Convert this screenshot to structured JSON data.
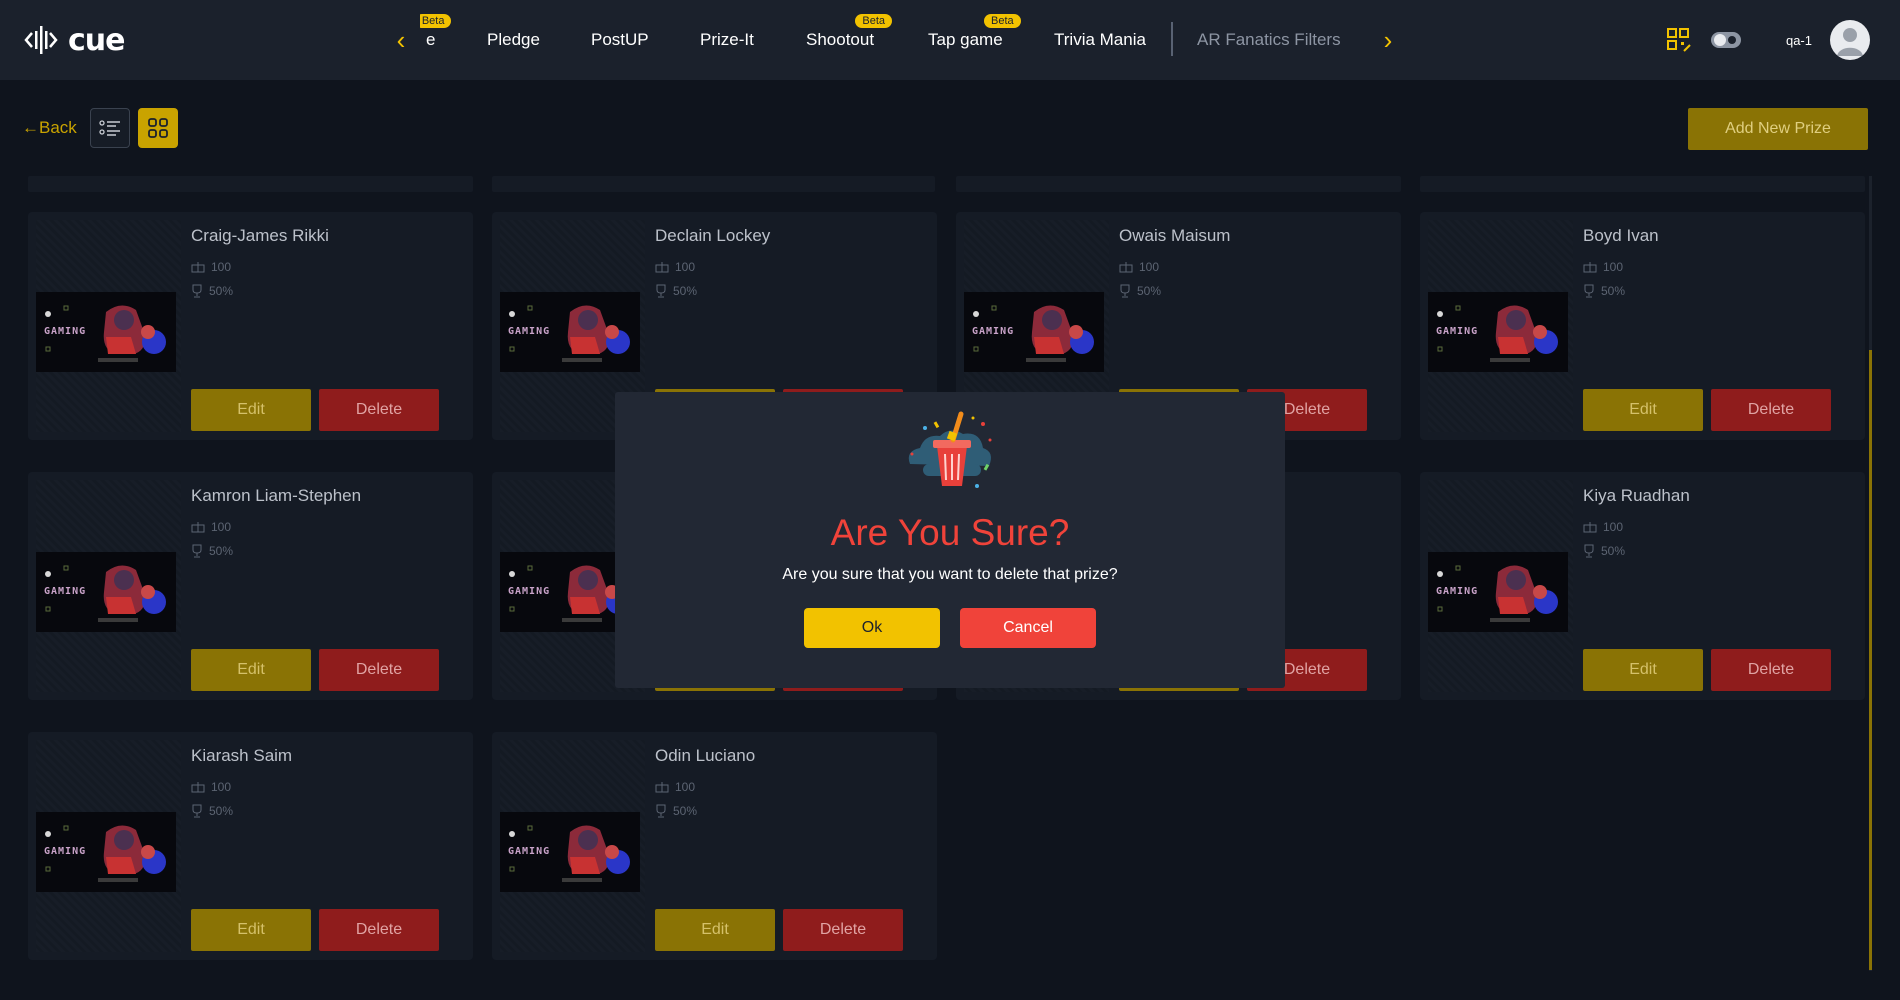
{
  "header": {
    "logo_text": "cue",
    "nav_items": [
      {
        "label": "e",
        "beta": "Beta"
      },
      {
        "label": "Pledge"
      },
      {
        "label": "PostUP"
      },
      {
        "label": "Prize-It"
      },
      {
        "label": "Shootout",
        "beta": "Beta"
      },
      {
        "label": "Tap game",
        "beta": "Beta"
      },
      {
        "label": "Trivia Mania"
      },
      {
        "label": "AR Fanatics Filters"
      }
    ],
    "user_name": "qa-1",
    "colors": {
      "accent": "#f2c200",
      "danger": "#f0433a",
      "bg": "#0f141d"
    }
  },
  "toolbar": {
    "back_label": "←Back",
    "add_prize_label": "Add New Prize"
  },
  "cards": [
    {
      "name": "Craig-James Rikki",
      "quantity": "100",
      "chance": "50%",
      "edit": "Edit",
      "delete": "Delete"
    },
    {
      "name": "Declain Lockey",
      "quantity": "100",
      "chance": "50%",
      "edit": "Edit",
      "delete": "Delete"
    },
    {
      "name": "Owais Maisum",
      "quantity": "100",
      "chance": "50%",
      "edit": "Edit",
      "delete": "Delete"
    },
    {
      "name": "Boyd Ivan",
      "quantity": "100",
      "chance": "50%",
      "edit": "Edit",
      "delete": "Delete"
    },
    {
      "name": "Kamron Liam-Stephen",
      "quantity": "100",
      "chance": "50%",
      "edit": "Edit",
      "delete": "Delete"
    },
    {
      "name": "",
      "quantity": "",
      "chance": "",
      "edit": "Edit",
      "delete": "Delete"
    },
    {
      "name": "",
      "quantity": "",
      "chance": "",
      "edit": "Edit",
      "delete": "Delete"
    },
    {
      "name": "Kiya Ruadhan",
      "quantity": "100",
      "chance": "50%",
      "edit": "Edit",
      "delete": "Delete"
    },
    {
      "name": "Kiarash Saim",
      "quantity": "100",
      "chance": "50%",
      "edit": "Edit",
      "delete": "Delete"
    },
    {
      "name": "Odin Luciano",
      "quantity": "100",
      "chance": "50%",
      "edit": "Edit",
      "delete": "Delete"
    }
  ],
  "thumbnail_text": "GAMING",
  "modal": {
    "title": "Are You Sure?",
    "message": "Are you sure that you want to delete that prize?",
    "ok_label": "Ok",
    "cancel_label": "Cancel"
  }
}
